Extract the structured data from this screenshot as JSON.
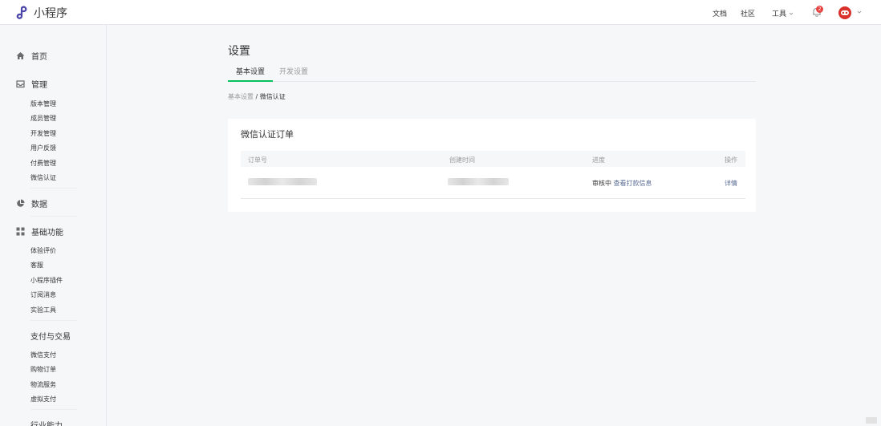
{
  "app": {
    "name": "小程序"
  },
  "topnav": {
    "links": [
      "文档",
      "社区"
    ],
    "tools_label": "工具",
    "notification_count": "2"
  },
  "sidebar": {
    "sections": [
      {
        "label": "首页",
        "icon": "home-icon"
      },
      {
        "label": "管理",
        "icon": "inbox-icon",
        "items": [
          "版本管理",
          "成员管理",
          "开发管理",
          "用户反馈",
          "付费管理",
          "微信认证"
        ]
      },
      {
        "label": "数据",
        "icon": "pie-chart-icon"
      },
      {
        "label": "基础功能",
        "icon": "grid-icon",
        "items": [
          "体验评价",
          "客服",
          "小程序插件",
          "订阅消息",
          "实验工具"
        ]
      },
      {
        "label": "支付与交易",
        "items": [
          "微信支付",
          "购物订单",
          "物流服务",
          "虚拟支付"
        ]
      },
      {
        "label": "行业能力"
      }
    ]
  },
  "main": {
    "title": "设置",
    "tabs": [
      {
        "label": "基本设置",
        "active": true
      },
      {
        "label": "开发设置",
        "active": false
      }
    ],
    "breadcrumb": {
      "parent": "基本设置",
      "separator": "/",
      "current": "微信认证"
    },
    "card": {
      "title": "微信认证订单",
      "columns": [
        "订单号",
        "创建时间",
        "进度",
        "操作"
      ],
      "rows": [
        {
          "order_id": "",
          "created_at": "",
          "status": "审核中",
          "status_link": "查看打款信息",
          "action": "详情"
        }
      ]
    }
  },
  "colors": {
    "accent": "#07c160",
    "link": "#576b95",
    "badge": "#e64340",
    "avatar": "#d8322a",
    "logo": "#4a45a8"
  }
}
